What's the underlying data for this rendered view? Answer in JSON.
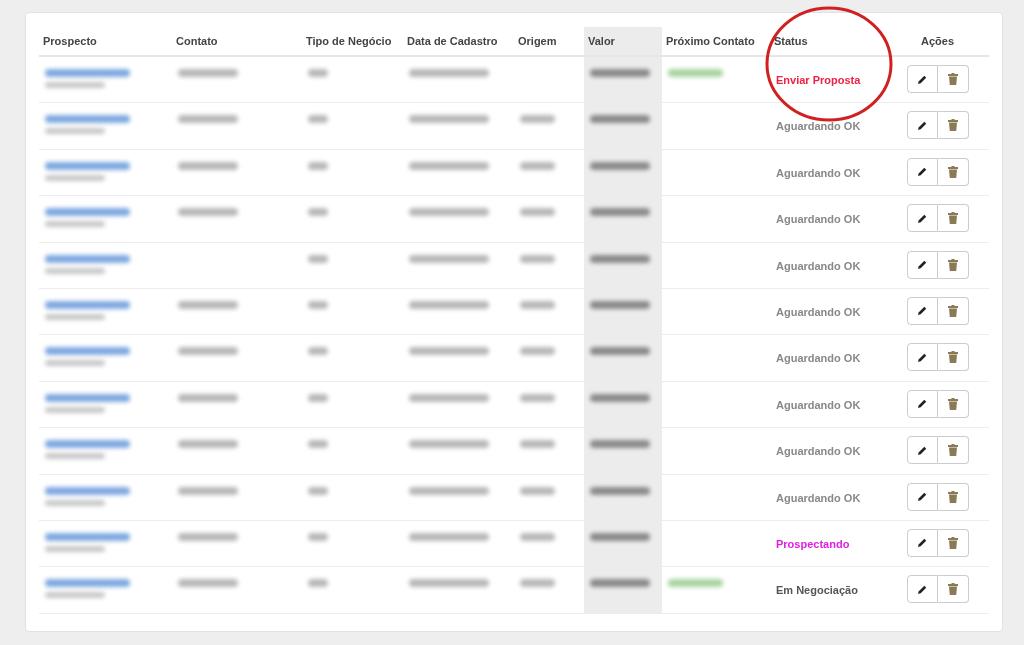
{
  "table": {
    "columns": [
      "Prospecto",
      "Contato",
      "Tipo de Negócio",
      "Data de Cadastro",
      "Origem",
      "Valor",
      "Próximo Contato",
      "Status",
      "Ações"
    ],
    "rows": [
      {
        "blurred": [
          true,
          true,
          true,
          true,
          false,
          true,
          true
        ],
        "status": {
          "label": "Enviar Proposta",
          "color": "#ee2244"
        }
      },
      {
        "blurred": [
          true,
          true,
          true,
          true,
          true,
          true,
          false
        ],
        "status": {
          "label": "Aguardando OK",
          "color": "#888888"
        }
      },
      {
        "blurred": [
          true,
          true,
          true,
          true,
          true,
          true,
          false
        ],
        "status": {
          "label": "Aguardando OK",
          "color": "#888888"
        }
      },
      {
        "blurred": [
          true,
          true,
          true,
          true,
          true,
          true,
          false
        ],
        "status": {
          "label": "Aguardando OK",
          "color": "#888888"
        }
      },
      {
        "blurred": [
          true,
          false,
          true,
          true,
          true,
          true,
          false
        ],
        "status": {
          "label": "Aguardando OK",
          "color": "#888888"
        }
      },
      {
        "blurred": [
          true,
          true,
          true,
          true,
          true,
          true,
          false
        ],
        "status": {
          "label": "Aguardando OK",
          "color": "#888888"
        }
      },
      {
        "blurred": [
          true,
          true,
          true,
          true,
          true,
          true,
          false
        ],
        "status": {
          "label": "Aguardando OK",
          "color": "#888888"
        }
      },
      {
        "blurred": [
          true,
          true,
          true,
          true,
          true,
          true,
          false
        ],
        "status": {
          "label": "Aguardando OK",
          "color": "#888888"
        }
      },
      {
        "blurred": [
          true,
          true,
          true,
          true,
          true,
          true,
          false
        ],
        "status": {
          "label": "Aguardando OK",
          "color": "#888888"
        }
      },
      {
        "blurred": [
          true,
          true,
          true,
          true,
          true,
          true,
          false
        ],
        "status": {
          "label": "Aguardando OK",
          "color": "#888888"
        }
      },
      {
        "blurred": [
          true,
          true,
          true,
          true,
          true,
          true,
          false
        ],
        "status": {
          "label": "Prospectando",
          "color": "#e020e0"
        }
      },
      {
        "blurred": [
          true,
          true,
          true,
          true,
          true,
          true,
          true
        ],
        "status": {
          "label": "Em Negociação",
          "color": "#555555"
        }
      }
    ]
  }
}
